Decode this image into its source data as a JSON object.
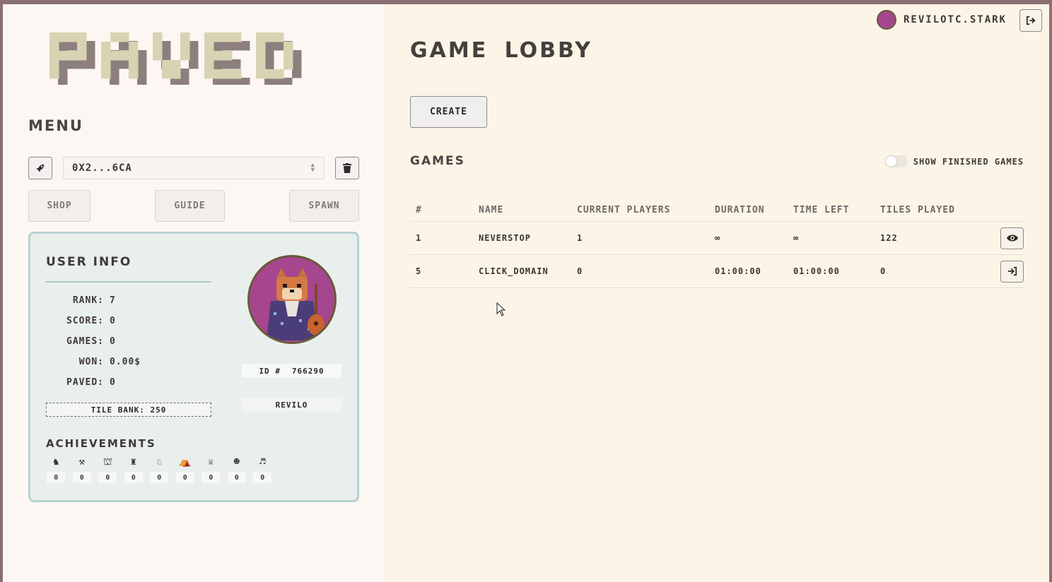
{
  "logo": {
    "text": "PAVED"
  },
  "sidebar": {
    "menu_title": "MENU",
    "account_select": "0X2...6CA",
    "nav": {
      "shop": "SHOP",
      "guide": "GUIDE",
      "spawn": "SPAWN"
    }
  },
  "user_info": {
    "title": "USER INFO",
    "stats": [
      {
        "key": "RANK:",
        "value": "7"
      },
      {
        "key": "SCORE:",
        "value": "0"
      },
      {
        "key": "GAMES:",
        "value": "0"
      },
      {
        "key": "WON:",
        "value": "0.00$"
      },
      {
        "key": "PAVED:",
        "value": "0"
      }
    ],
    "tile_bank": "TILE BANK: 250",
    "id_label": "ID #",
    "id_value": "766290",
    "name": "REVILO",
    "achievements_title": "ACHIEVEMENTS",
    "achievements": [
      {
        "icon": "knight-icon",
        "count": "0"
      },
      {
        "icon": "hammer-icon",
        "count": "0"
      },
      {
        "icon": "castle-icon",
        "count": "0"
      },
      {
        "icon": "rook-icon",
        "count": "0"
      },
      {
        "icon": "horse-icon",
        "count": "0"
      },
      {
        "icon": "camp-icon",
        "count": "0"
      },
      {
        "icon": "trophy-icon",
        "count": "0"
      },
      {
        "icon": "people-icon",
        "count": "0"
      },
      {
        "icon": "bird-icon",
        "count": "0"
      }
    ]
  },
  "header": {
    "username": "REVILOTC.STARK"
  },
  "lobby": {
    "title": "GAME LOBBY",
    "create_label": "CREATE",
    "games_title": "GAMES",
    "show_finished_label": "SHOW FINISHED GAMES",
    "show_finished": false,
    "columns": [
      "#",
      "NAME",
      "CURRENT PLAYERS",
      "DURATION",
      "TIME LEFT",
      "TILES PLAYED"
    ],
    "rows": [
      {
        "id": "1",
        "name": "NEVERSTOP",
        "players": "1",
        "duration": "∞",
        "time_left": "∞",
        "tiles": "122",
        "action": "view-icon"
      },
      {
        "id": "5",
        "name": "CLICK_DOMAIN",
        "players": "0",
        "duration": "01:00:00",
        "time_left": "01:00:00",
        "tiles": "0",
        "action": "join-icon"
      }
    ]
  }
}
